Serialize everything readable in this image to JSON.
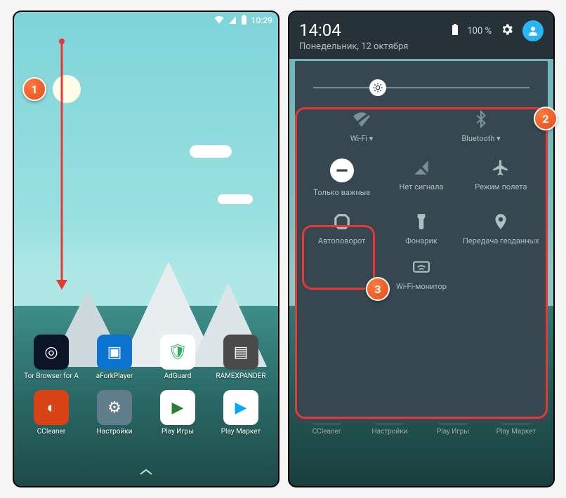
{
  "annotations": {
    "n1": "1",
    "n2": "2",
    "n3": "3"
  },
  "left": {
    "status": {
      "time": "10:29"
    },
    "apps": [
      {
        "name": "tor",
        "label": "Tor Browser for A",
        "bg": "#0b1527",
        "glyph": "◎"
      },
      {
        "name": "aforkplayer",
        "label": "aForkPlayer",
        "bg": "#0b74d1",
        "glyph": "▣"
      },
      {
        "name": "adguard",
        "label": "AdGuard",
        "bg": "#ffffff",
        "glyph": "🛡",
        "fg": "#27ae60"
      },
      {
        "name": "ramexpander",
        "label": "RAMEXPANDER",
        "bg": "#4a4a4a",
        "glyph": "▤"
      },
      {
        "name": "ccleaner",
        "label": "CCleaner",
        "bg": "#d84315",
        "glyph": "◐"
      },
      {
        "name": "settings",
        "label": "Настройки",
        "bg": "#607d8b",
        "glyph": "⚙"
      },
      {
        "name": "playgames",
        "label": "Play Игры",
        "bg": "#ffffff",
        "glyph": "▶",
        "fg": "#2e7d32"
      },
      {
        "name": "playmarket",
        "label": "Play Маркет",
        "bg": "#ffffff",
        "glyph": "▶",
        "fg": "#03a9f4"
      }
    ]
  },
  "right": {
    "header": {
      "time": "14:04",
      "date": "Понедельник, 12 октября",
      "battery_pct": "100 %"
    },
    "brightness_pct": 26,
    "tiles_top": [
      {
        "name": "wifi",
        "label": "Wi-Fi ▾"
      },
      {
        "name": "bluetooth",
        "label": "Bluetooth ▾"
      }
    ],
    "tiles": [
      {
        "name": "dnd",
        "label": "Только важные"
      },
      {
        "name": "cellular",
        "label": "Нет сигнала"
      },
      {
        "name": "airplane",
        "label": "Режим полета"
      },
      {
        "name": "autorotate",
        "label": "Автоповорот"
      },
      {
        "name": "flashlight",
        "label": "Фонарик"
      },
      {
        "name": "location",
        "label": "Передача геоданных"
      }
    ],
    "bottom_tile": {
      "name": "wifimonitor",
      "label": "Wi-Fi-монитор"
    },
    "faded_apps": [
      {
        "label": "CCleaner"
      },
      {
        "label": "Настройки"
      },
      {
        "label": "Play Игры"
      },
      {
        "label": "Play Маркет"
      }
    ]
  }
}
